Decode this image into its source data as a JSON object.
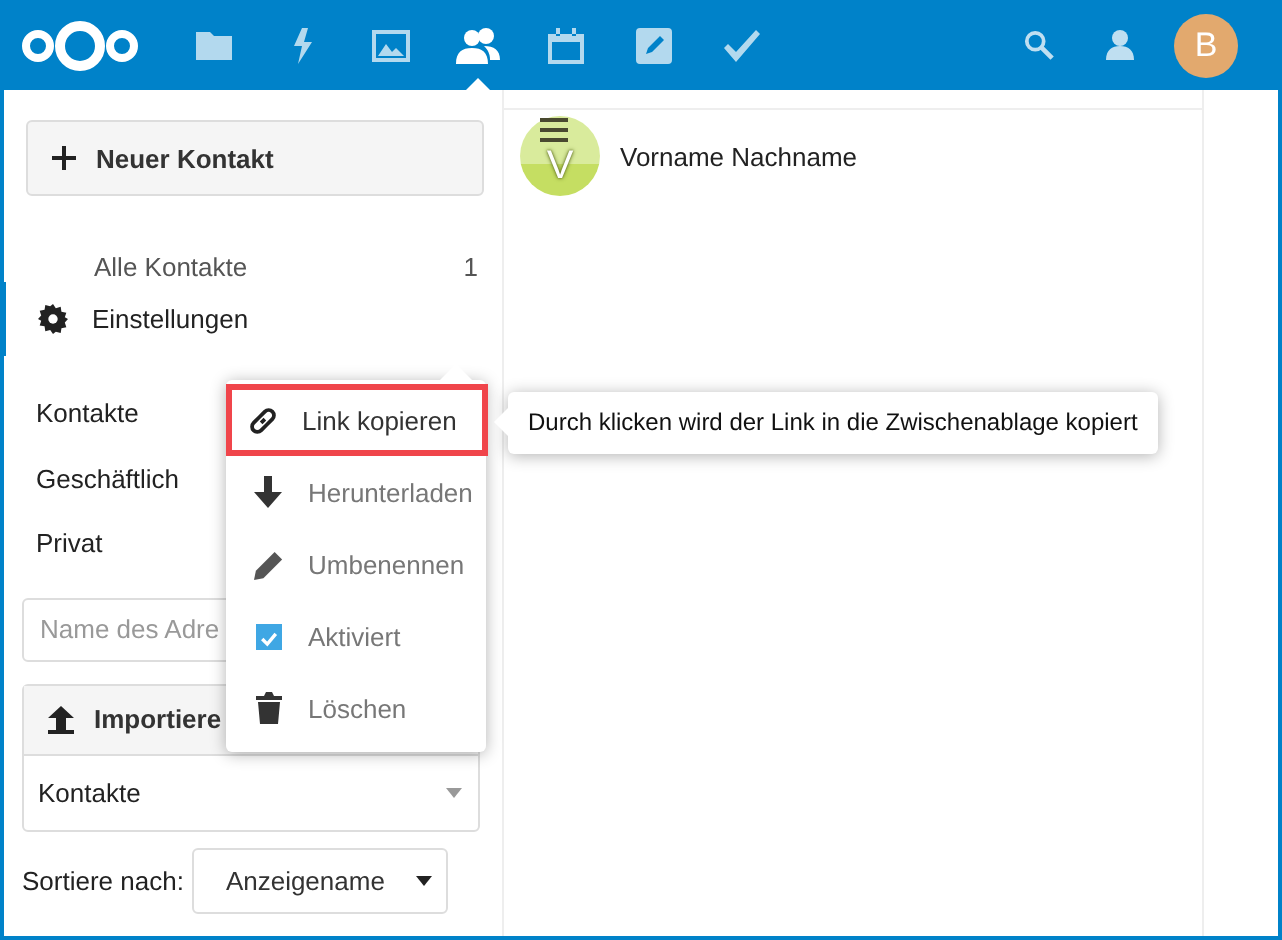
{
  "header": {
    "apps": [
      {
        "selected": false
      },
      {
        "selected": false
      },
      {
        "selected": false
      },
      {
        "selected": true
      },
      {
        "selected": false
      },
      {
        "selected": false
      },
      {
        "selected": false
      }
    ],
    "avatar": "B"
  },
  "sidebar": {
    "new_contact_button": "Neuer Kontakt",
    "groups": [
      {
        "label": "Alle Kontakte",
        "count": "1"
      }
    ],
    "settings": "Einstellungen",
    "address_books": [
      "Kontakte",
      "Geschäftlich",
      "Privat"
    ],
    "new_address_book": {
      "placeholder": "Name des Adre"
    },
    "import": {
      "button": "Importiere",
      "target": "Kontakte"
    },
    "sort": {
      "label": "Sortiere nach:",
      "value": "Anzeigename"
    }
  },
  "contacts": [
    {
      "initial": "V",
      "name": "Vorname Nachname"
    }
  ],
  "menu": {
    "items": [
      {
        "kind": "action",
        "label": "Link kopieren",
        "selected": true
      },
      {
        "kind": "action",
        "label": "Herunterladen",
        "selected": false
      },
      {
        "kind": "action",
        "label": "Umbenennen",
        "selected": false
      },
      {
        "kind": "checkbox",
        "label": "Aktiviert",
        "checked": true,
        "selected": false
      },
      {
        "kind": "action",
        "label": "Löschen",
        "selected": false
      }
    ]
  },
  "tooltip": "Durch klicken wird der Link in die Zwischenablage kopiert"
}
